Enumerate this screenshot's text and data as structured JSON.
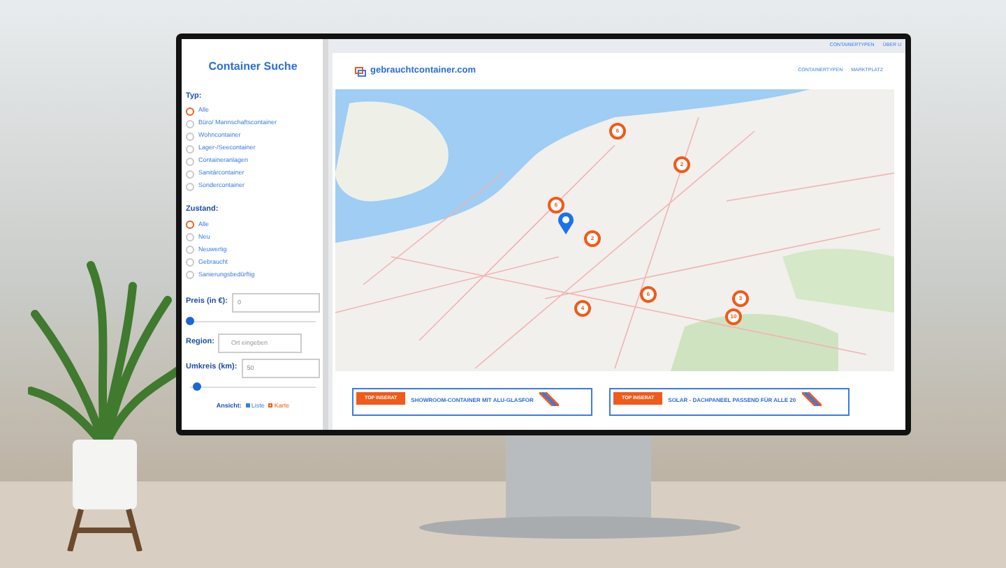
{
  "sidebar": {
    "title": "Container Suche",
    "filter_groups": [
      {
        "label": "Typ:",
        "options": [
          {
            "label": "Alle",
            "selected": true
          },
          {
            "label": "Büro/ Mannschaftscontainer",
            "selected": false
          },
          {
            "label": "Wohncontainer",
            "selected": false
          },
          {
            "label": "Lager-/Seecontainer",
            "selected": false
          },
          {
            "label": "Containeranlagen",
            "selected": false
          },
          {
            "label": "Sanitärcontainer",
            "selected": false
          },
          {
            "label": "Sondercontainer",
            "selected": false
          }
        ]
      },
      {
        "label": "Zustand:",
        "options": [
          {
            "label": "Alle",
            "selected": true
          },
          {
            "label": "Neu",
            "selected": false
          },
          {
            "label": "Neuwertig",
            "selected": false
          },
          {
            "label": "Gebraucht",
            "selected": false
          },
          {
            "label": "Sanierungsbedürftig",
            "selected": false
          }
        ]
      }
    ],
    "fields": [
      {
        "kind": "slider",
        "label": "Preis (in €):",
        "value": "0",
        "level": 0
      },
      {
        "kind": "text",
        "label": "Region:",
        "placeholder": "Ort eingeben"
      },
      {
        "kind": "slider",
        "label": "Umkreis (km):",
        "value": "50",
        "level": 0.05
      }
    ],
    "view": {
      "label": "Ansicht:",
      "options": [
        {
          "label": "Liste",
          "selected": false
        },
        {
          "label": "Karte",
          "selected": true
        }
      ]
    }
  },
  "top_bar": {
    "links": [
      "CONTAINERTYPEN",
      "ÜBER U"
    ]
  },
  "header": {
    "logo": "gebrauchtcontainer.com",
    "nav": [
      "CONTAINERTYPEN",
      "MARKTPLATZ"
    ]
  },
  "map": {
    "markers": [
      {
        "count": "6"
      },
      {
        "count": "2"
      },
      {
        "count": "6"
      },
      {
        "count": "2"
      },
      {
        "count": "4"
      },
      {
        "count": "6"
      },
      {
        "count": "3"
      },
      {
        "count": "10"
      }
    ]
  },
  "listings": [
    {
      "badge": "TOP INSERAT",
      "title": "SHOWROOM-CONTAINER MIT ALU-GLASFOR"
    },
    {
      "badge": "TOP INSERAT",
      "title": "SOLAR - DACHPANEEL PASSEND FÜR ALLE 20"
    }
  ]
}
